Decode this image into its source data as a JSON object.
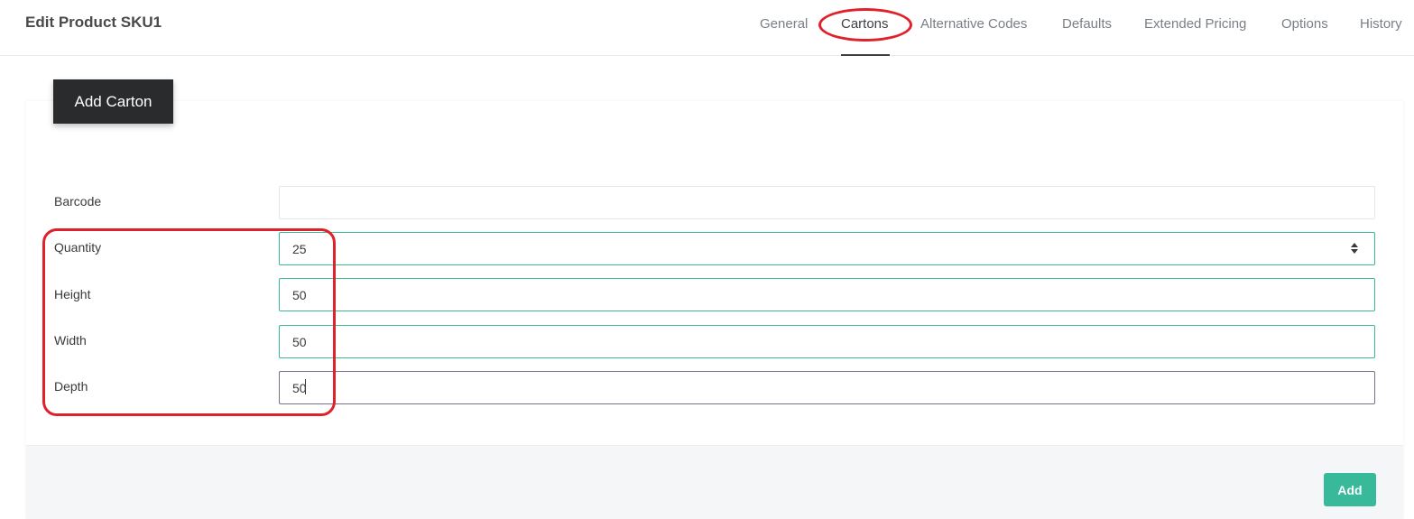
{
  "header": {
    "title": "Edit Product SKU1"
  },
  "tabs": [
    {
      "label": "General"
    },
    {
      "label": "Cartons"
    },
    {
      "label": "Alternative Codes"
    },
    {
      "label": "Defaults"
    },
    {
      "label": "Extended Pricing"
    },
    {
      "label": "Options"
    },
    {
      "label": "History"
    }
  ],
  "active_tab": "Cartons",
  "form": {
    "add_carton_label": "Add Carton",
    "fields": [
      {
        "label": "Barcode",
        "value": ""
      },
      {
        "label": "Quantity",
        "value": "25"
      },
      {
        "label": "Height",
        "value": "50"
      },
      {
        "label": "Width",
        "value": "50"
      },
      {
        "label": "Depth",
        "value": "50"
      }
    ],
    "submit_label": "Add"
  },
  "colors": {
    "accent": "#38b999",
    "dark_button": "#292b2c",
    "annotation": "#e0202b"
  }
}
